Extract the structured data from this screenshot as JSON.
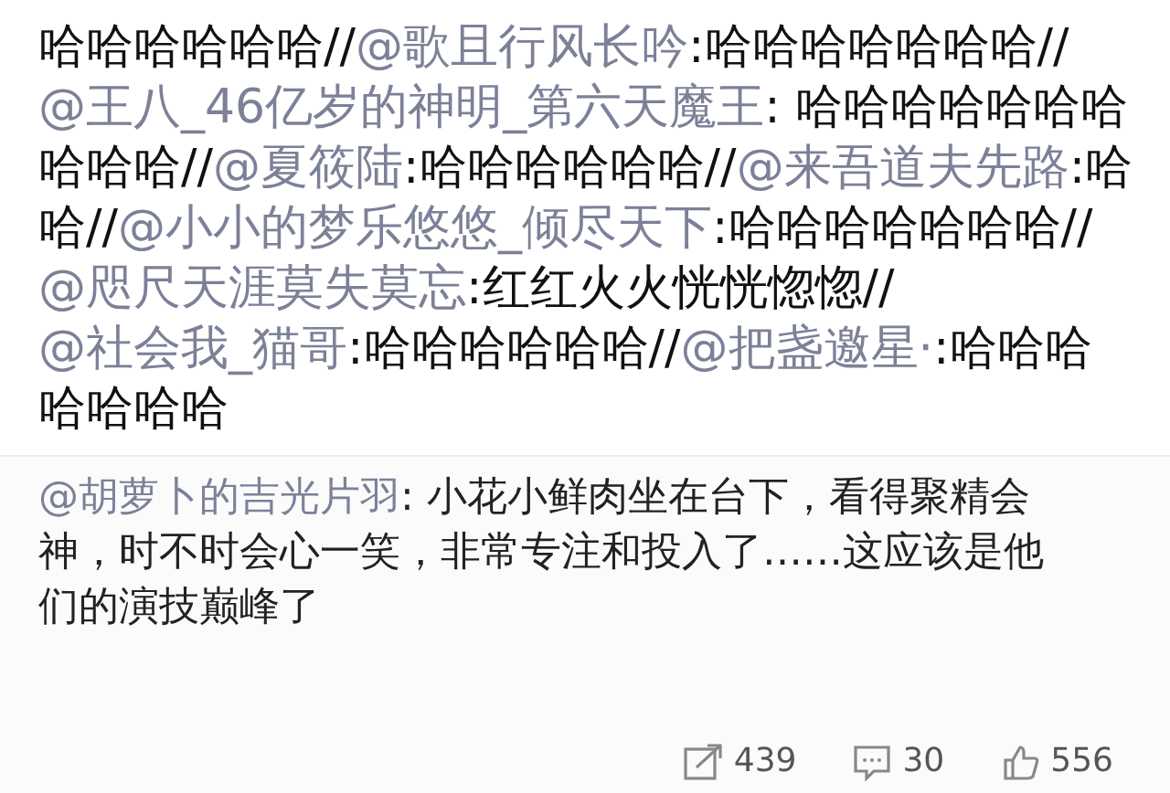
{
  "repost": {
    "segments": [
      {
        "kind": "text",
        "text": "哈哈哈哈哈哈//"
      },
      {
        "kind": "mention",
        "text": "@歌且行风长吟"
      },
      {
        "kind": "text",
        "text": ":哈哈哈哈哈哈哈//"
      },
      {
        "kind": "mention",
        "text": "@王八_46亿岁的神明_第六天魔王"
      },
      {
        "kind": "text",
        "text": ": 哈哈哈哈哈哈哈哈哈哈//"
      },
      {
        "kind": "mention",
        "text": "@夏筱陆"
      },
      {
        "kind": "text",
        "text": ":哈哈哈哈哈哈//"
      },
      {
        "kind": "mention",
        "text": "@来吾道夫先路"
      },
      {
        "kind": "text",
        "text": ":哈哈//"
      },
      {
        "kind": "mention",
        "text": "@小小的梦乐悠悠_倾尽天下"
      },
      {
        "kind": "text",
        "text": ":哈哈哈哈哈哈哈//"
      },
      {
        "kind": "mention",
        "text": "@咫尺天涯莫失莫忘"
      },
      {
        "kind": "text",
        "text": ":红红火火恍恍惚惚//"
      },
      {
        "kind": "mention",
        "text": "@社会我_猫哥"
      },
      {
        "kind": "text",
        "text": ":哈哈哈哈哈哈//"
      },
      {
        "kind": "mention",
        "text": "@把盏邀星·"
      },
      {
        "kind": "text",
        "text": ":哈哈哈哈哈哈哈"
      }
    ]
  },
  "original": {
    "segments": [
      {
        "kind": "mention",
        "text": "@胡萝卜的吉光片羽"
      },
      {
        "kind": "text",
        "text": ": 小花小鲜肉坐在台下，看得聚精会神，时不时会心一笑，非常专注和投入了……这应该是他们的演技巅峰了"
      }
    ]
  },
  "actions": [
    {
      "kind": "repost",
      "count": "439"
    },
    {
      "kind": "comment",
      "count": "30"
    },
    {
      "kind": "like",
      "count": "556"
    }
  ]
}
